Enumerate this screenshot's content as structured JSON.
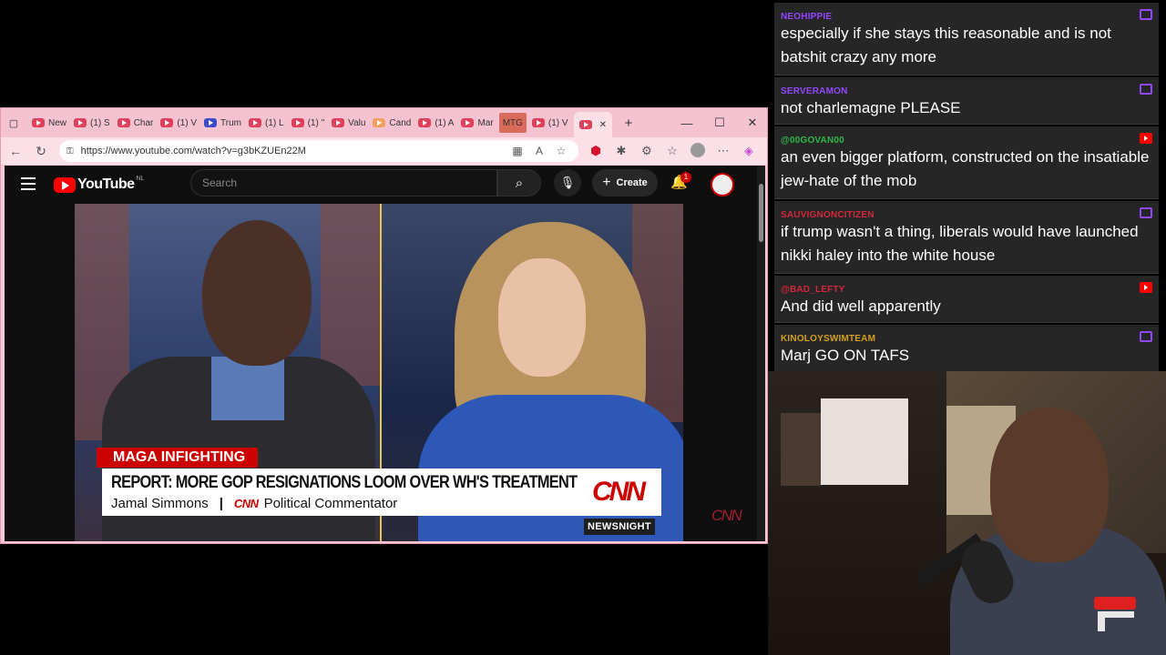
{
  "browser": {
    "tabs": [
      {
        "label": "New",
        "kind": "yt"
      },
      {
        "label": "(1) S",
        "kind": "yt"
      },
      {
        "label": "Char",
        "kind": "yt"
      },
      {
        "label": "(1) V",
        "kind": "yt"
      },
      {
        "label": "Trum",
        "kind": "blue"
      },
      {
        "label": "(1) L",
        "kind": "yt"
      },
      {
        "label": "(1) \"",
        "kind": "yt"
      },
      {
        "label": "Valu",
        "kind": "yt"
      },
      {
        "label": "Cand",
        "kind": "orange"
      },
      {
        "label": "(1) A",
        "kind": "yt"
      },
      {
        "label": "Mar",
        "kind": "yt"
      },
      {
        "label": "MTG",
        "kind": "mtg"
      },
      {
        "label": "(1) V",
        "kind": "yt"
      }
    ],
    "close_tab": "✕",
    "new_tab": "+",
    "url": "https://www.youtube.com/watch?v=g3bKZUEn22M",
    "win_min": "—",
    "win_max": "☐",
    "win_close": "✕"
  },
  "youtube": {
    "logo": "YouTube",
    "region": "NL",
    "search_placeholder": "Search",
    "create_label": "Create",
    "notification_count": "1"
  },
  "video": {
    "tag": "MAGA INFIGHTING",
    "headline": "REPORT: MORE GOP RESIGNATIONS LOOM OVER WH'S TREATMENT",
    "name": "Jamal Simmons",
    "separator": "|",
    "network_small": "CNN",
    "title_role": "Political Commentator",
    "network_big": "CNN",
    "show": "NEWSNIGHT",
    "corner_logo": "CNN"
  },
  "chat": [
    {
      "user": "NEOHIPPIE",
      "color": "#9146ff",
      "platform": "twitch",
      "text": "especially if she stays this reasonable and is not batshit crazy any more"
    },
    {
      "user": "SERVERAMON",
      "color": "#9146ff",
      "platform": "twitch",
      "text": "not charlemagne PLEASE"
    },
    {
      "user": "@00GOVAN00",
      "color": "#2fb84a",
      "platform": "youtube",
      "text": "an even bigger platform, constructed on the insatiable jew-hate of the mob"
    },
    {
      "user": "SAUVIGNONCITIZEN",
      "color": "#d4263a",
      "platform": "twitch",
      "text": "if trump wasn't a thing, liberals would have launched nikki haley into the white house"
    },
    {
      "user": "@BAD_LEFTY",
      "color": "#d4263a",
      "platform": "youtube",
      "text": "And did well apparently"
    },
    {
      "user": "KINOLOYSWIMTEAM",
      "color": "#d4a017",
      "platform": "twitch",
      "text": "Marj GO ON TAFS"
    }
  ]
}
